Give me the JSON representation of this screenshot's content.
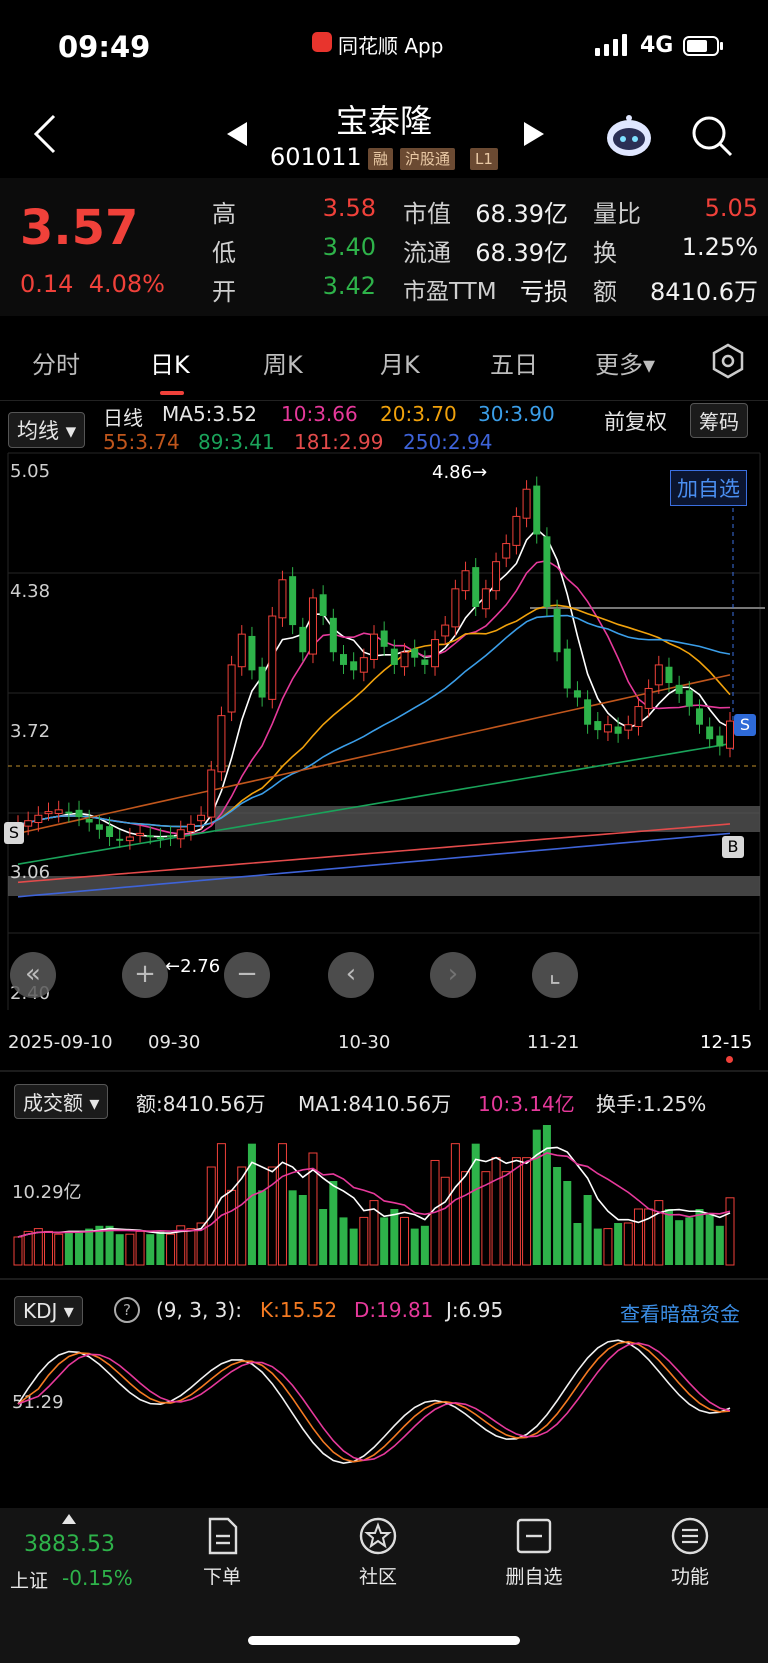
{
  "status_bar": {
    "time": "09:49",
    "app_label": "同花顺 App",
    "network": "4G"
  },
  "header": {
    "title": "宝泰隆",
    "code": "601011",
    "tags": [
      "融",
      "沪股通",
      "L1"
    ]
  },
  "quote": {
    "price": "3.57",
    "change": "0.14",
    "change_pct": "4.08%",
    "stats": [
      {
        "label": "高",
        "value": "3.58",
        "color": "red"
      },
      {
        "label": "低",
        "value": "3.40",
        "color": "green"
      },
      {
        "label": "开",
        "value": "3.42",
        "color": "green"
      }
    ],
    "stats2": [
      {
        "label": "市值",
        "value": "68.39亿"
      },
      {
        "label": "流通",
        "value": "68.39亿"
      },
      {
        "label": "市盈TTM",
        "value": "亏损"
      }
    ],
    "stats3": [
      {
        "label": "量比",
        "value": "5.05",
        "color": "red"
      },
      {
        "label": "换",
        "value": "1.25%",
        "color": "white"
      },
      {
        "label": "额",
        "value": "8410.6万",
        "color": "white"
      }
    ]
  },
  "tabs": [
    "分时",
    "日K",
    "周K",
    "月K",
    "五日",
    "更多▾"
  ],
  "ma_header": {
    "selector": "均线",
    "period": "日线",
    "ma5": "MA5:3.52",
    "ma10": "10:3.66",
    "ma20": "20:3.70",
    "ma30": "30:3.90",
    "ma55": "55:3.74",
    "ma89": "89:3.41",
    "ma181": "181:2.99",
    "ma250": "250:2.94",
    "adjust": "前复权",
    "chips": "筹码"
  },
  "chart_data": {
    "type": "candlestick",
    "y_ticks": [
      "5.05",
      "4.38",
      "3.72",
      "3.06",
      "2.40"
    ],
    "x_ticks": [
      "2025-09-10",
      "09-30",
      "10-30",
      "11-21",
      "12-15"
    ],
    "high_label": "4.86",
    "low_label": "2.76",
    "add_watch": "加自选",
    "colors": {
      "up": "#f0413a",
      "down": "#2eb34a",
      "ma5": "#ffffff",
      "ma10": "#e6399b",
      "ma20": "#f1a20c",
      "ma30": "#3b9ee8",
      "ma55": "#c0561c",
      "ma89": "#1aa35a",
      "ma181": "#e34b4b",
      "ma250": "#3e63d8"
    }
  },
  "volume": {
    "selector": "成交额",
    "amount": "额:8410.56万",
    "ma1": "MA1:8410.56万",
    "ma10": "10:3.14亿",
    "turnover": "换手:1.25%",
    "y_tick": "10.29亿"
  },
  "kdj": {
    "selector": "KDJ",
    "params": "(9, 3, 3):",
    "k": "K:15.52",
    "d": "D:19.81",
    "j": "J:6.95",
    "link": "查看暗盘资金",
    "y_tick": "51.29"
  },
  "bottom_bar": {
    "index_value": "3883.53",
    "index_name": "上证",
    "index_change": "-0.15%",
    "items": [
      {
        "label": "下单",
        "icon": "order-icon"
      },
      {
        "label": "社区",
        "icon": "community-icon"
      },
      {
        "label": "删自选",
        "icon": "remove-watch-icon"
      },
      {
        "label": "功能",
        "icon": "menu-icon"
      }
    ]
  }
}
